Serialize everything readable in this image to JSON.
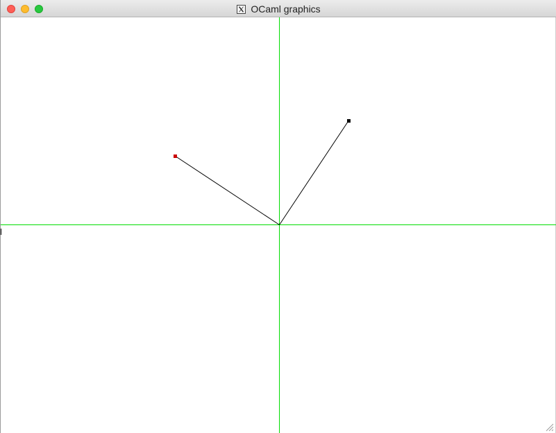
{
  "window": {
    "title": "OCaml graphics",
    "title_icon": "x11-icon"
  },
  "traffic_lights": {
    "close": "#fe5f57",
    "minimize": "#febc2e",
    "maximize": "#28c840"
  },
  "colors": {
    "axes": "#00dd00",
    "line": "#000000",
    "red_point": "#cc0000",
    "black_point": "#000000",
    "background": "#ffffff"
  }
}
